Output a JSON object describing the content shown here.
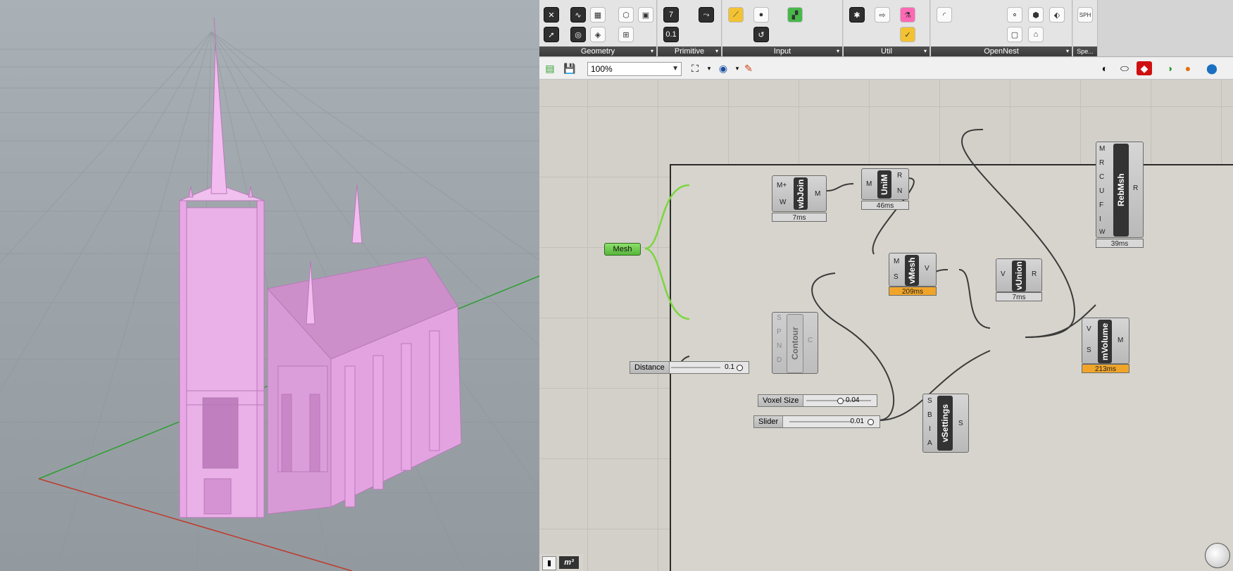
{
  "ribbon": {
    "groups": [
      {
        "label": "Geometry"
      },
      {
        "label": "Primitive"
      },
      {
        "label": "Input"
      },
      {
        "label": "Util"
      },
      {
        "label": "OpenNest"
      },
      {
        "label": "Spe..."
      }
    ],
    "primitive_icons": [
      "7",
      "0.1"
    ],
    "spe_badge": "SPH"
  },
  "toolbar": {
    "zoom": "100%"
  },
  "canvas": {
    "mesh_param": "Mesh",
    "components": {
      "mbjoin": {
        "name": "wbJoin",
        "inputs": [
          "M+",
          "W"
        ],
        "outputs": [
          "M"
        ],
        "time": "7ms"
      },
      "unim": {
        "name": "UniM",
        "inputs": [
          "M"
        ],
        "outputs": [
          "R",
          "N"
        ],
        "time": "46ms"
      },
      "rebmsh": {
        "name": "RebMsh",
        "inputs": [
          "M",
          "R",
          "C",
          "U",
          "F",
          "I",
          "W"
        ],
        "outputs": [
          "R"
        ],
        "time": "39ms"
      },
      "vmesh": {
        "name": "vMesh",
        "inputs": [
          "M",
          "S"
        ],
        "outputs": [
          "V"
        ],
        "time": "209ms"
      },
      "vunion": {
        "name": "vUnion",
        "inputs": [
          "V"
        ],
        "outputs": [
          "R"
        ],
        "time": "7ms"
      },
      "contour": {
        "name": "Contour",
        "inputs": [
          "S",
          "P",
          "N",
          "D"
        ],
        "outputs": [
          "C"
        ]
      },
      "mvolume": {
        "name": "mVolume",
        "inputs": [
          "V",
          "S"
        ],
        "outputs": [
          "M"
        ],
        "time": "213ms"
      },
      "vsettings": {
        "name": "vSettings",
        "inputs": [
          "S",
          "B",
          "I",
          "A"
        ],
        "outputs": [
          "S"
        ]
      }
    },
    "sliders": {
      "distance": {
        "label": "Distance",
        "value": "0.1"
      },
      "voxel": {
        "label": "Voxel Size",
        "value": "0.04"
      },
      "slider": {
        "label": "Slider",
        "value": "0.01"
      }
    },
    "status_label": "m³"
  },
  "colors": {
    "model_pink": "#e8a8e6",
    "warn_orange": "#f0a52a",
    "param_green": "#55b53a",
    "axis_red": "#c0392b",
    "axis_green": "#2e9e2e"
  }
}
